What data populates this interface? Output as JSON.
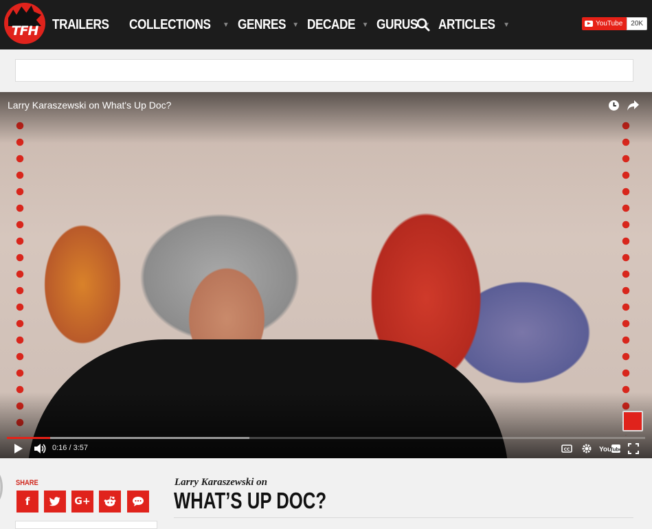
{
  "nav": {
    "logo_text": "TFH",
    "items": [
      {
        "label": "TRAILERS",
        "has_caret": false
      },
      {
        "label": "COLLECTIONS",
        "has_caret": true
      },
      {
        "label": "GENRES",
        "has_caret": true
      },
      {
        "label": "DECADE",
        "has_caret": true
      },
      {
        "label": "GURUS",
        "has_caret": true
      },
      {
        "label": "ARTICLES",
        "has_caret": true
      }
    ],
    "search_icon": "search-icon",
    "youtube": {
      "label": "YouTube",
      "count": "20K"
    }
  },
  "video": {
    "title": "Larry Karaszewski on What's Up Doc?",
    "current_time": "0:16",
    "duration": "3:57",
    "time_display": "0:16 / 3:57",
    "played_fraction": 0.068,
    "buffered_fraction": 0.38,
    "icons": [
      "watch-later-icon",
      "share-icon",
      "play-icon",
      "volume-icon",
      "captions-icon",
      "settings-icon",
      "youtube-logo",
      "fullscreen-icon"
    ],
    "brand_color": "#e62117"
  },
  "share": {
    "label": "SHARE",
    "buttons": [
      {
        "name": "facebook",
        "glyph": "f"
      },
      {
        "name": "twitter",
        "glyph": "t"
      },
      {
        "name": "google-plus",
        "glyph": "G+"
      },
      {
        "name": "reddit",
        "glyph": "r"
      },
      {
        "name": "comment",
        "glyph": "…"
      }
    ]
  },
  "article": {
    "kicker": "Larry Karaszewski on",
    "headline": "WHAT’S UP DOC?"
  },
  "colors": {
    "accent": "#e0231c",
    "nav_bg": "#1c1c1c",
    "page_bg": "#f1f1f1"
  }
}
